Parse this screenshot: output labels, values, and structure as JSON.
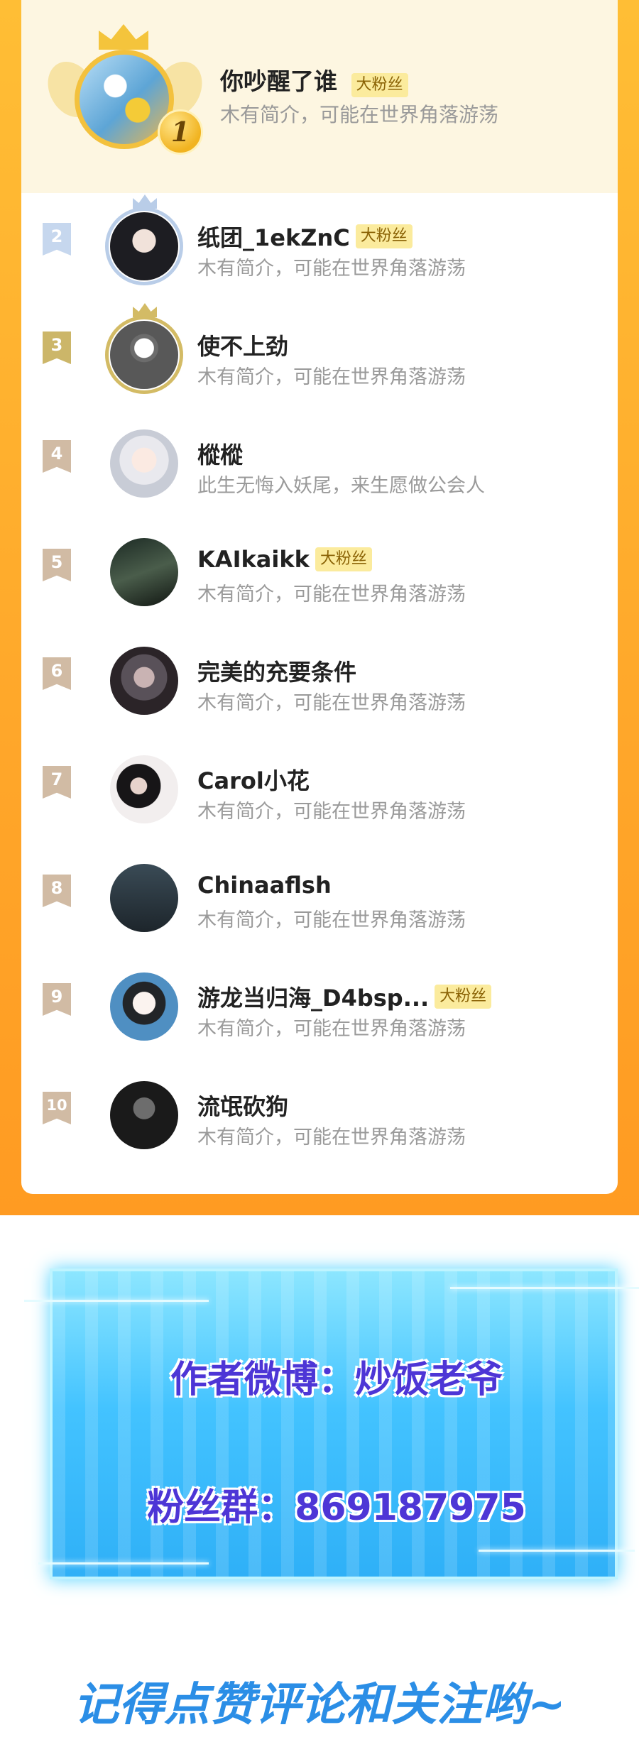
{
  "ranking": {
    "top": {
      "rank": "1",
      "name": "你吵醒了谁",
      "tag": "大粉丝",
      "bio": "木有简介，可能在世界角落游荡"
    },
    "rows": [
      {
        "rank": "2",
        "name": "纸团_1ekZnC",
        "tag": "大粉丝",
        "bio": "木有简介，可能在世界角落游荡"
      },
      {
        "rank": "3",
        "name": "使不上劲",
        "tag": "",
        "bio": "木有简介，可能在世界角落游荡"
      },
      {
        "rank": "4",
        "name": "樅樅",
        "tag": "",
        "bio": "此生无悔入妖尾，来生愿做公会人"
      },
      {
        "rank": "5",
        "name": "KAIkaikk",
        "tag": "大粉丝",
        "bio": "木有简介，可能在世界角落游荡"
      },
      {
        "rank": "6",
        "name": "完美的充要条件",
        "tag": "",
        "bio": "木有简介，可能在世界角落游荡"
      },
      {
        "rank": "7",
        "name": "Carol小花",
        "tag": "",
        "bio": "木有简介，可能在世界角落游荡"
      },
      {
        "rank": "8",
        "name": "Chinaaflsh",
        "tag": "",
        "bio": "木有简介，可能在世界角落游荡"
      },
      {
        "rank": "9",
        "name": "游龙当归海_D4bsp...",
        "tag": "大粉丝",
        "bio": "木有简介，可能在世界角落游荡"
      },
      {
        "rank": "10",
        "name": "流氓砍狗",
        "tag": "",
        "bio": "木有简介，可能在世界角落游荡"
      }
    ]
  },
  "promo": {
    "weibo": "作者微博：炒饭老爷",
    "fan_group": "粉丝群：869187975"
  },
  "footer": {
    "follow": "记得点赞评论和关注哟~"
  }
}
